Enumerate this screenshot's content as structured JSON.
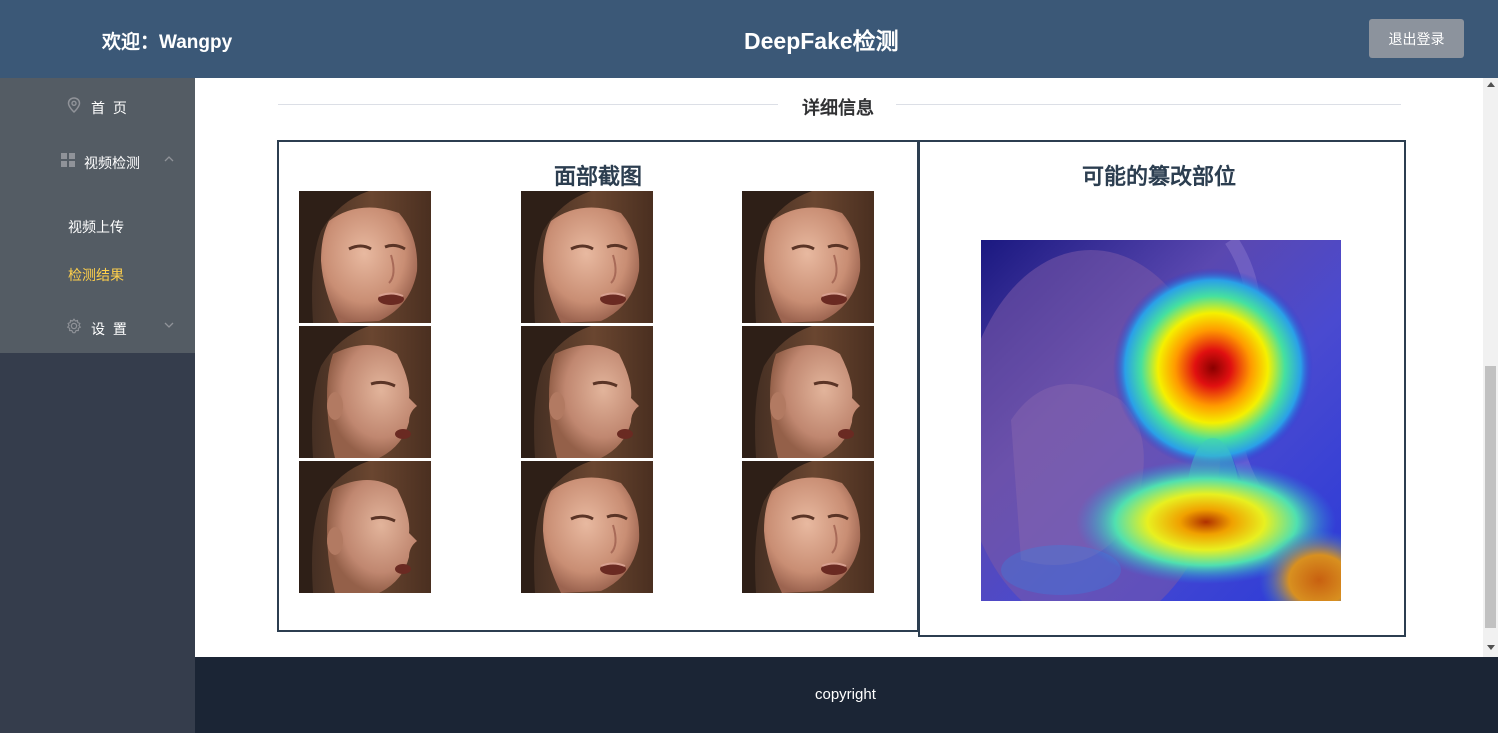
{
  "header": {
    "welcome": "欢迎：Wangpy",
    "title": "DeepFake检测",
    "logout_label": "退出登录"
  },
  "sidebar": {
    "home_label": "首 页",
    "video_detect_label": "视频检测",
    "sub_items": [
      {
        "label": "视频上传"
      },
      {
        "label": "检测结果"
      }
    ],
    "settings_label": "设 置"
  },
  "main": {
    "section_title": "详细信息",
    "faces_title": "面部截图",
    "heatmap_title": "可能的篡改部位"
  },
  "footer": {
    "copyright": "copyright"
  },
  "colors": {
    "header_bg": "#3b5877",
    "sidebar_bg": "#353d4c",
    "menu_bg": "#545c64",
    "active_text": "#ffd04b",
    "panel_border": "#2c3e50",
    "footer_bg": "#1b2535",
    "logout_bg": "#8c939d"
  },
  "icons": [
    "location-icon",
    "grid-icon",
    "gear-icon",
    "chevron-up-icon",
    "chevron-down-icon"
  ]
}
